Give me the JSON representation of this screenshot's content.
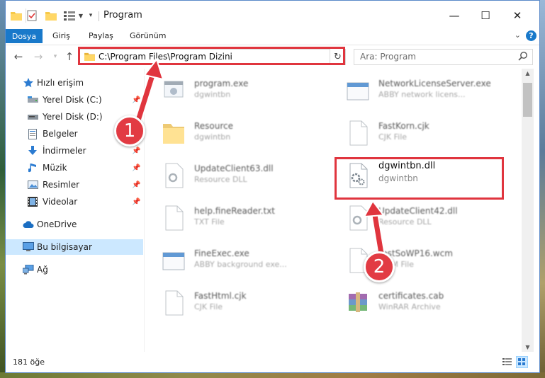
{
  "window": {
    "title": "Program",
    "colors": {
      "accent": "#1979ca",
      "selection": "#cce8ff",
      "annotation": "#e0353e"
    }
  },
  "ribbon": {
    "file_tab": "Dosya",
    "tabs": [
      "Giriş",
      "Paylaş",
      "Görünüm"
    ]
  },
  "address": {
    "path": "C:\\Program Files\\Program Dizini",
    "search_placeholder": "Ara: Program"
  },
  "sidebar": {
    "quick_access": "Hızlı erişim",
    "items": [
      {
        "label": "Yerel Disk (C:)",
        "icon": "drive-icon",
        "pinned": true
      },
      {
        "label": "Yerel Disk (D:)",
        "icon": "drive-icon",
        "pinned": false
      },
      {
        "label": "Belgeler",
        "icon": "documents-icon",
        "pinned": true
      },
      {
        "label": "İndirmeler",
        "icon": "download-icon",
        "pinned": true
      },
      {
        "label": "Müzik",
        "icon": "music-icon",
        "pinned": true
      },
      {
        "label": "Resimler",
        "icon": "pictures-icon",
        "pinned": true
      },
      {
        "label": "Videolar",
        "icon": "videos-icon",
        "pinned": true
      }
    ],
    "onedrive": "OneDrive",
    "this_pc": "Bu bilgisayar",
    "network": "Ağ"
  },
  "files": [
    {
      "name": "program.exe",
      "type": "dgwintbn",
      "icon": "exe-icon"
    },
    {
      "name": "NetworkLicenseServer.exe",
      "type": "ABBY network licens...",
      "icon": "exe-window-icon"
    },
    {
      "name": "Resource",
      "type": "dgwintbn",
      "icon": "folder-icon"
    },
    {
      "name": "FastKorn.cjk",
      "type": "CJK File",
      "icon": "blank-file-icon"
    },
    {
      "name": "UpdateClient63.dll",
      "type": "Resource DLL",
      "icon": "dll-icon"
    },
    {
      "name": "dgwintbn.dll",
      "type": "dgwintbn",
      "icon": "dll-gear-icon",
      "highlighted": true
    },
    {
      "name": "help.fineReader.txt",
      "type": "TXT File",
      "icon": "blank-file-icon"
    },
    {
      "name": "UpdateClient42.dll",
      "type": "Resource DLL",
      "icon": "dll-icon"
    },
    {
      "name": "FineExec.exe",
      "type": "ABBY background exe...",
      "icon": "exe-window-icon"
    },
    {
      "name": "TestSoWP16.wcm",
      "type": "WCM File",
      "icon": "blank-file-icon"
    },
    {
      "name": "FastHtml.cjk",
      "type": "CJK File",
      "icon": "blank-file-icon"
    },
    {
      "name": "certificates.cab",
      "type": "WinRAR Archive",
      "icon": "winrar-icon"
    }
  ],
  "status": {
    "count": "181 öğe"
  },
  "annotations": [
    "1",
    "2"
  ]
}
